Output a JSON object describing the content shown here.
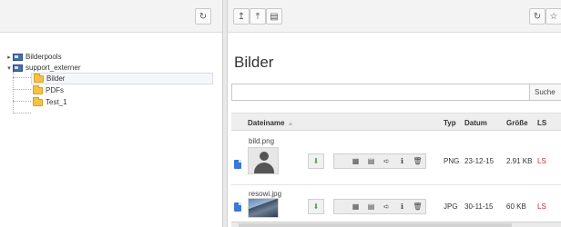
{
  "left_panel": {
    "tree": [
      {
        "label": "Bilderpools",
        "icon": "pool-icon",
        "expanded": false
      },
      {
        "label": "support_externer",
        "icon": "pool-icon",
        "expanded": true
      },
      {
        "label": "Bilder",
        "icon": "folder-icon",
        "selected": true
      },
      {
        "label": "PDFs",
        "icon": "folder-icon"
      },
      {
        "label": "Test_1",
        "icon": "folder-icon"
      }
    ]
  },
  "right_panel": {
    "title": "Bilder",
    "search": {
      "value": "",
      "placeholder": "",
      "button_label": "Suche"
    },
    "table": {
      "columns": [
        "Dateiname",
        "Typ",
        "Datum",
        "Größe",
        "LS"
      ],
      "rows": [
        {
          "name": "bild.png",
          "type": "PNG",
          "date": "23-12-15",
          "size": "2.91 KB",
          "ls": "LS",
          "thumb": "avatar-placeholder"
        },
        {
          "name": "resowi.jpg",
          "type": "JPG",
          "date": "30-11-15",
          "size": "60 KB",
          "ls": "LS",
          "thumb": "photo"
        }
      ]
    }
  },
  "colors": {
    "ls_red": "#d42a2a",
    "folder": "#f5c242",
    "file_icon": "#3a79d6"
  }
}
